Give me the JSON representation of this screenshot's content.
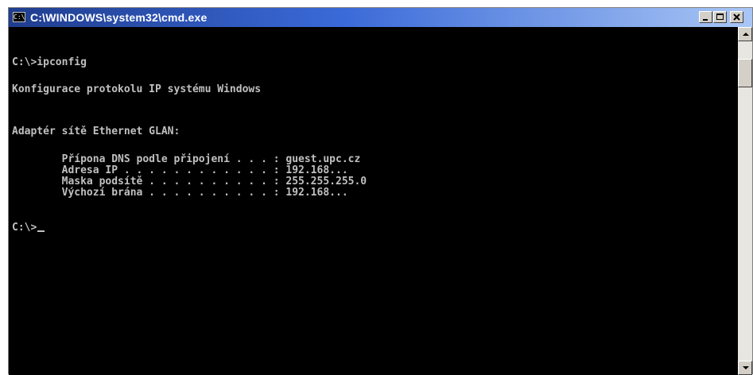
{
  "window": {
    "title": "C:\\WINDOWS\\system32\\cmd.exe",
    "icon_label": "C:\\"
  },
  "console": {
    "lines": [
      "C:\\>ipconfig",
      "Konfigurace protokolu IP systému Windows",
      "Adaptér sítě Ethernet GLAN:",
      "        Přípona DNS podle připojení . . . : guest.upc.cz",
      "        Adresa IP . . . . . . . . . . . . : 192.168...",
      "        Maska podsítě . . . . . . . . . . : 255.255.255.0",
      "        Výchozí brána . . . . . . . . . . : 192.168..."
    ],
    "prompt": "C:\\>"
  },
  "icons": [
    "cmd-icon",
    "minimize-icon",
    "maximize-icon",
    "close-icon",
    "scroll-up-icon",
    "scroll-down-icon"
  ]
}
